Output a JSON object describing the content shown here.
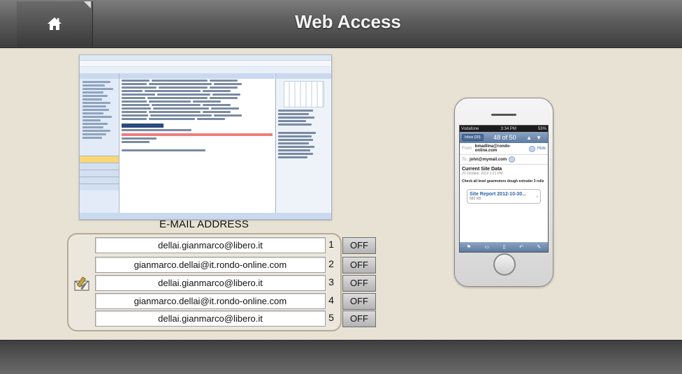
{
  "header": {
    "title": "Web Access",
    "home_icon": "home-icon"
  },
  "email_section": {
    "label": "E-MAIL ADDRESS",
    "icon": "mail-settings-icon",
    "entries": [
      {
        "address": "dellai.gianmarco@libero.it",
        "index": "1",
        "status": "OFF"
      },
      {
        "address": "gianmarco.dellai@it.rondo-online.com",
        "index": "2",
        "status": "OFF"
      },
      {
        "address": "dellai.gianmarco@libero.it",
        "index": "3",
        "status": "OFF"
      },
      {
        "address": "gianmarco.dellai@it.rondo-online.com",
        "index": "4",
        "status": "OFF"
      },
      {
        "address": "dellai.gianmarco@libero.it",
        "index": "5",
        "status": "OFF"
      }
    ]
  },
  "phone": {
    "carrier": "Vodafone",
    "time": "3:34 PM",
    "battery": "53%",
    "back_label": "Inbox (20)",
    "count": "48 of 50",
    "from_label": "From:",
    "from_value": "bmadlina@rondo-online.com",
    "hide_label": "Hide",
    "to_label": "To:",
    "to_value": "john@mymail.com",
    "subject": "Current Site Data",
    "date": "31 October, 2012 1:21 PM",
    "body": "Check all level gearmotors dough extruder 3 rolls",
    "attachment_name": "Site Report 2012-10-30...",
    "attachment_size": "583 KB"
  },
  "colors": {
    "background": "#e8e2d5",
    "header": "#5c5c5c",
    "panel_border": "#b5aa98"
  }
}
